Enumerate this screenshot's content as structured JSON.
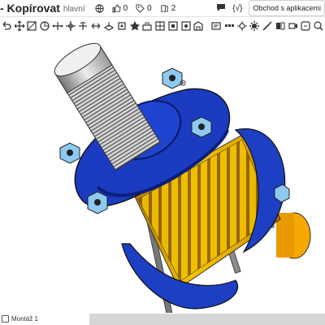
{
  "header": {
    "title": "- Kopírovat",
    "branch": "hlavní",
    "likes": "0",
    "comments": "0",
    "versions": "2",
    "store_label": "Obchod s aplikacemi"
  },
  "bottom": {
    "tab_label": "Montáž 1"
  },
  "colors": {
    "accent": "#1b55d3",
    "model_blue": "#0b2ea0",
    "model_yellow": "#e6b000",
    "bolt_blue": "#8ec9f2"
  }
}
